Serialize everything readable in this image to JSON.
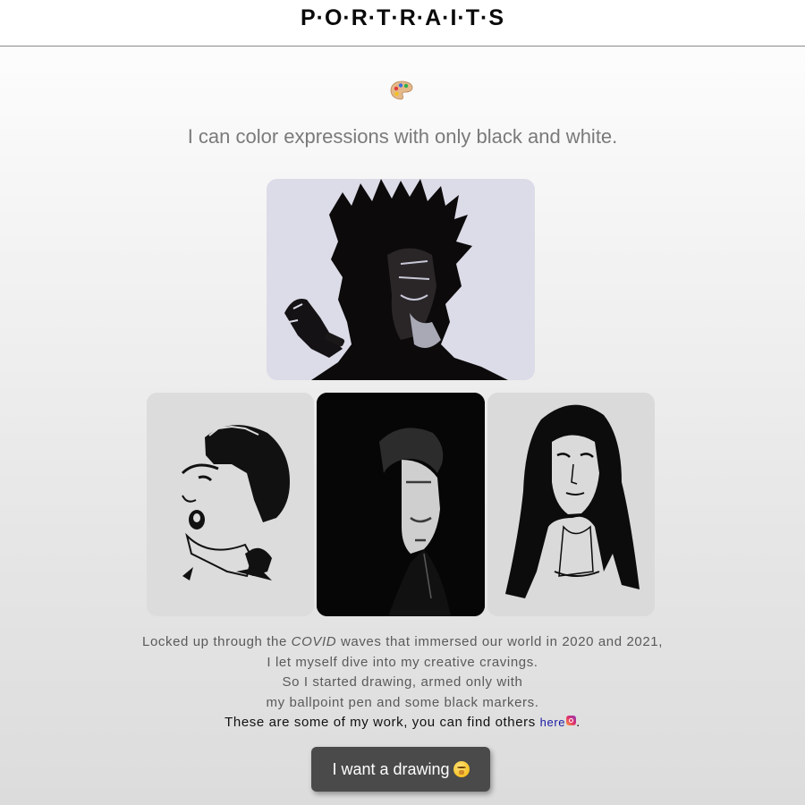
{
  "header": {
    "title": "P·O·R·T·R·A·I·T·S"
  },
  "intro": {
    "icon": "palette-icon",
    "tagline": "I can color expressions with only black and white."
  },
  "gallery": {
    "items": [
      {
        "name": "portrait-cigar-man"
      },
      {
        "name": "portrait-woman-headscarf"
      },
      {
        "name": "portrait-half-shadow-man"
      },
      {
        "name": "portrait-long-hair-woman"
      }
    ]
  },
  "story": {
    "line1_pre": "Locked up through the ",
    "line1_em": "COVID",
    "line1_post": " waves that immersed our world in 2020 and 2021,",
    "line2": "I let myself dive into my creative cravings.",
    "line3": "So I started drawing, armed only with",
    "line4": "my ballpoint pen and some black markers.",
    "line5_pre": "These are some of my work, you can find others ",
    "link_label": "here",
    "link_icon": "instagram-icon",
    "line5_post": "."
  },
  "cta": {
    "label": "I want a drawing",
    "emoji": "face-with-hand-over-mouth-icon"
  },
  "colors": {
    "button_bg": "#4a4a4a",
    "link": "#1a1aa6",
    "tagline": "#7a7a7a"
  }
}
